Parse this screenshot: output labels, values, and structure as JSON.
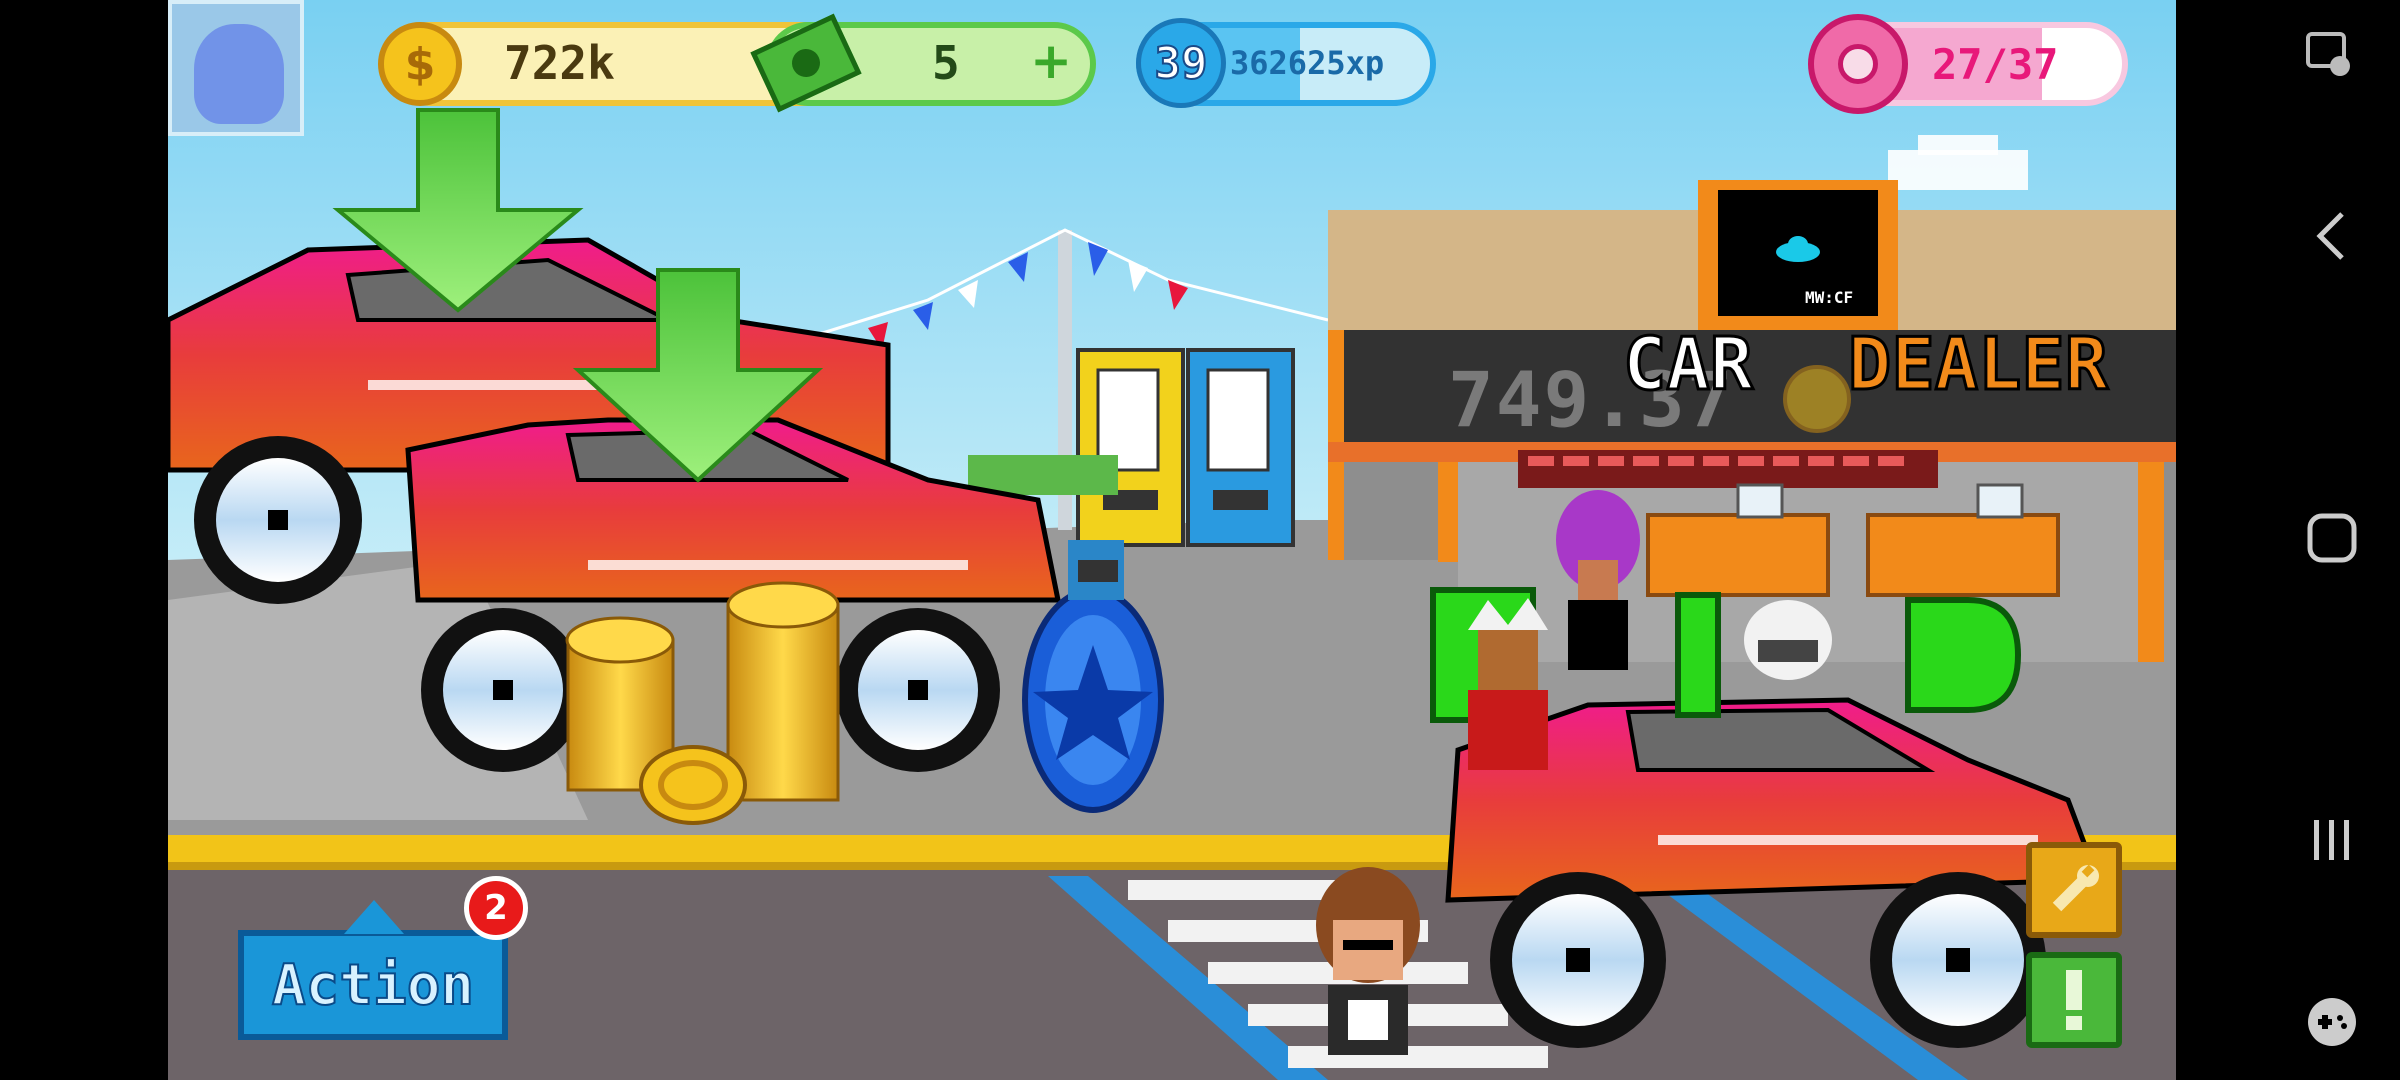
{
  "hud": {
    "coins": "722k",
    "cash": "5",
    "level": "39",
    "xp": "362625xp",
    "donuts": "27/37",
    "donut_progress": 0.73,
    "xp_progress": 0.55
  },
  "shop": {
    "sign_left": "CAR",
    "sign_right": "DEALER",
    "logo_text": "MW:CF",
    "floating_value": "749.37"
  },
  "action": {
    "label": "Action",
    "badge": "2"
  },
  "icons": {
    "avatar": "avatar-icon",
    "coin": "coin-icon",
    "cash": "cash-icon",
    "xp": "xp-star-icon",
    "donut": "donut-icon",
    "wrench": "wrench-icon",
    "alert": "exclamation-icon",
    "nav_gesture": "gesture-icon",
    "nav_back": "back-icon",
    "nav_home": "home-icon",
    "nav_recents": "recents-icon",
    "nav_game": "gamepad-icon"
  },
  "colors": {
    "sky": "#7fd2f0",
    "coin_gold": "#f5c31c",
    "cash_green": "#5cc94a",
    "xp_blue": "#2aa8e8",
    "donut_pink": "#f06aa8",
    "car_magenta": "#e8187a",
    "sign_orange": "#f28a1a"
  }
}
